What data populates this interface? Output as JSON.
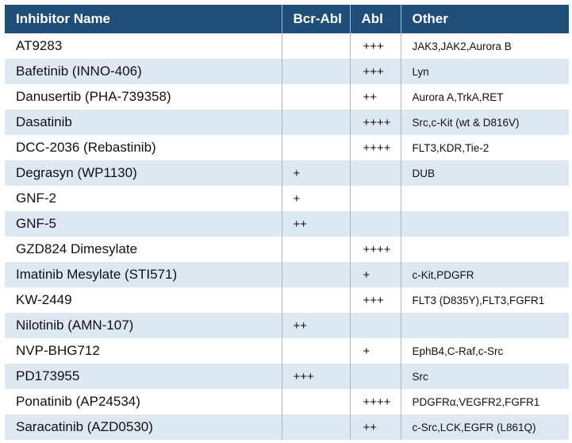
{
  "table": {
    "headers": [
      "Inhibitor Name",
      "Bcr-Abl",
      "Abl",
      "Other"
    ],
    "rows": [
      {
        "name": "AT9283",
        "bcr_abl": "",
        "abl": "+++",
        "other": "JAK3,JAK2,Aurora B"
      },
      {
        "name": "Bafetinib (INNO-406)",
        "bcr_abl": "",
        "abl": "+++",
        "other": "Lyn"
      },
      {
        "name": "Danusertib (PHA-739358)",
        "bcr_abl": "",
        "abl": "++",
        "other": "Aurora A,TrkA,RET"
      },
      {
        "name": "Dasatinib",
        "bcr_abl": "",
        "abl": "++++",
        "other": "Src,c-Kit (wt & D816V)"
      },
      {
        "name": "DCC-2036 (Rebastinib)",
        "bcr_abl": "",
        "abl": "++++",
        "other": "FLT3,KDR,Tie-2"
      },
      {
        "name": "Degrasyn (WP1130)",
        "bcr_abl": "+",
        "abl": "",
        "other": "DUB"
      },
      {
        "name": "GNF-2",
        "bcr_abl": "+",
        "abl": "",
        "other": ""
      },
      {
        "name": "GNF-5",
        "bcr_abl": "++",
        "abl": "",
        "other": ""
      },
      {
        "name": "GZD824 Dimesylate",
        "bcr_abl": "",
        "abl": "++++",
        "other": ""
      },
      {
        "name": "Imatinib Mesylate (STI571)",
        "bcr_abl": "",
        "abl": "+",
        "other": "c-Kit,PDGFR"
      },
      {
        "name": "KW-2449",
        "bcr_abl": "",
        "abl": "+++",
        "other": "FLT3 (D835Y),FLT3,FGFR1"
      },
      {
        "name": "Nilotinib (AMN-107)",
        "bcr_abl": "++",
        "abl": "",
        "other": ""
      },
      {
        "name": "NVP-BHG712",
        "bcr_abl": "",
        "abl": "+",
        "other": "EphB4,C-Raf,c-Src"
      },
      {
        "name": "PD173955",
        "bcr_abl": "+++",
        "abl": "",
        "other": "Src"
      },
      {
        "name": "Ponatinib (AP24534)",
        "bcr_abl": "",
        "abl": "++++",
        "other": "PDGFRα,VEGFR2,FGFR1"
      },
      {
        "name": "Saracatinib (AZD0530)",
        "bcr_abl": "",
        "abl": "++",
        "other": "c-Src,LCK,EGFR (L861Q)"
      }
    ]
  },
  "colors": {
    "header_bg": "#1f4e79",
    "header_text": "#ffffff",
    "row_stripe": "#dde8f3",
    "row_plain": "#ffffff"
  }
}
